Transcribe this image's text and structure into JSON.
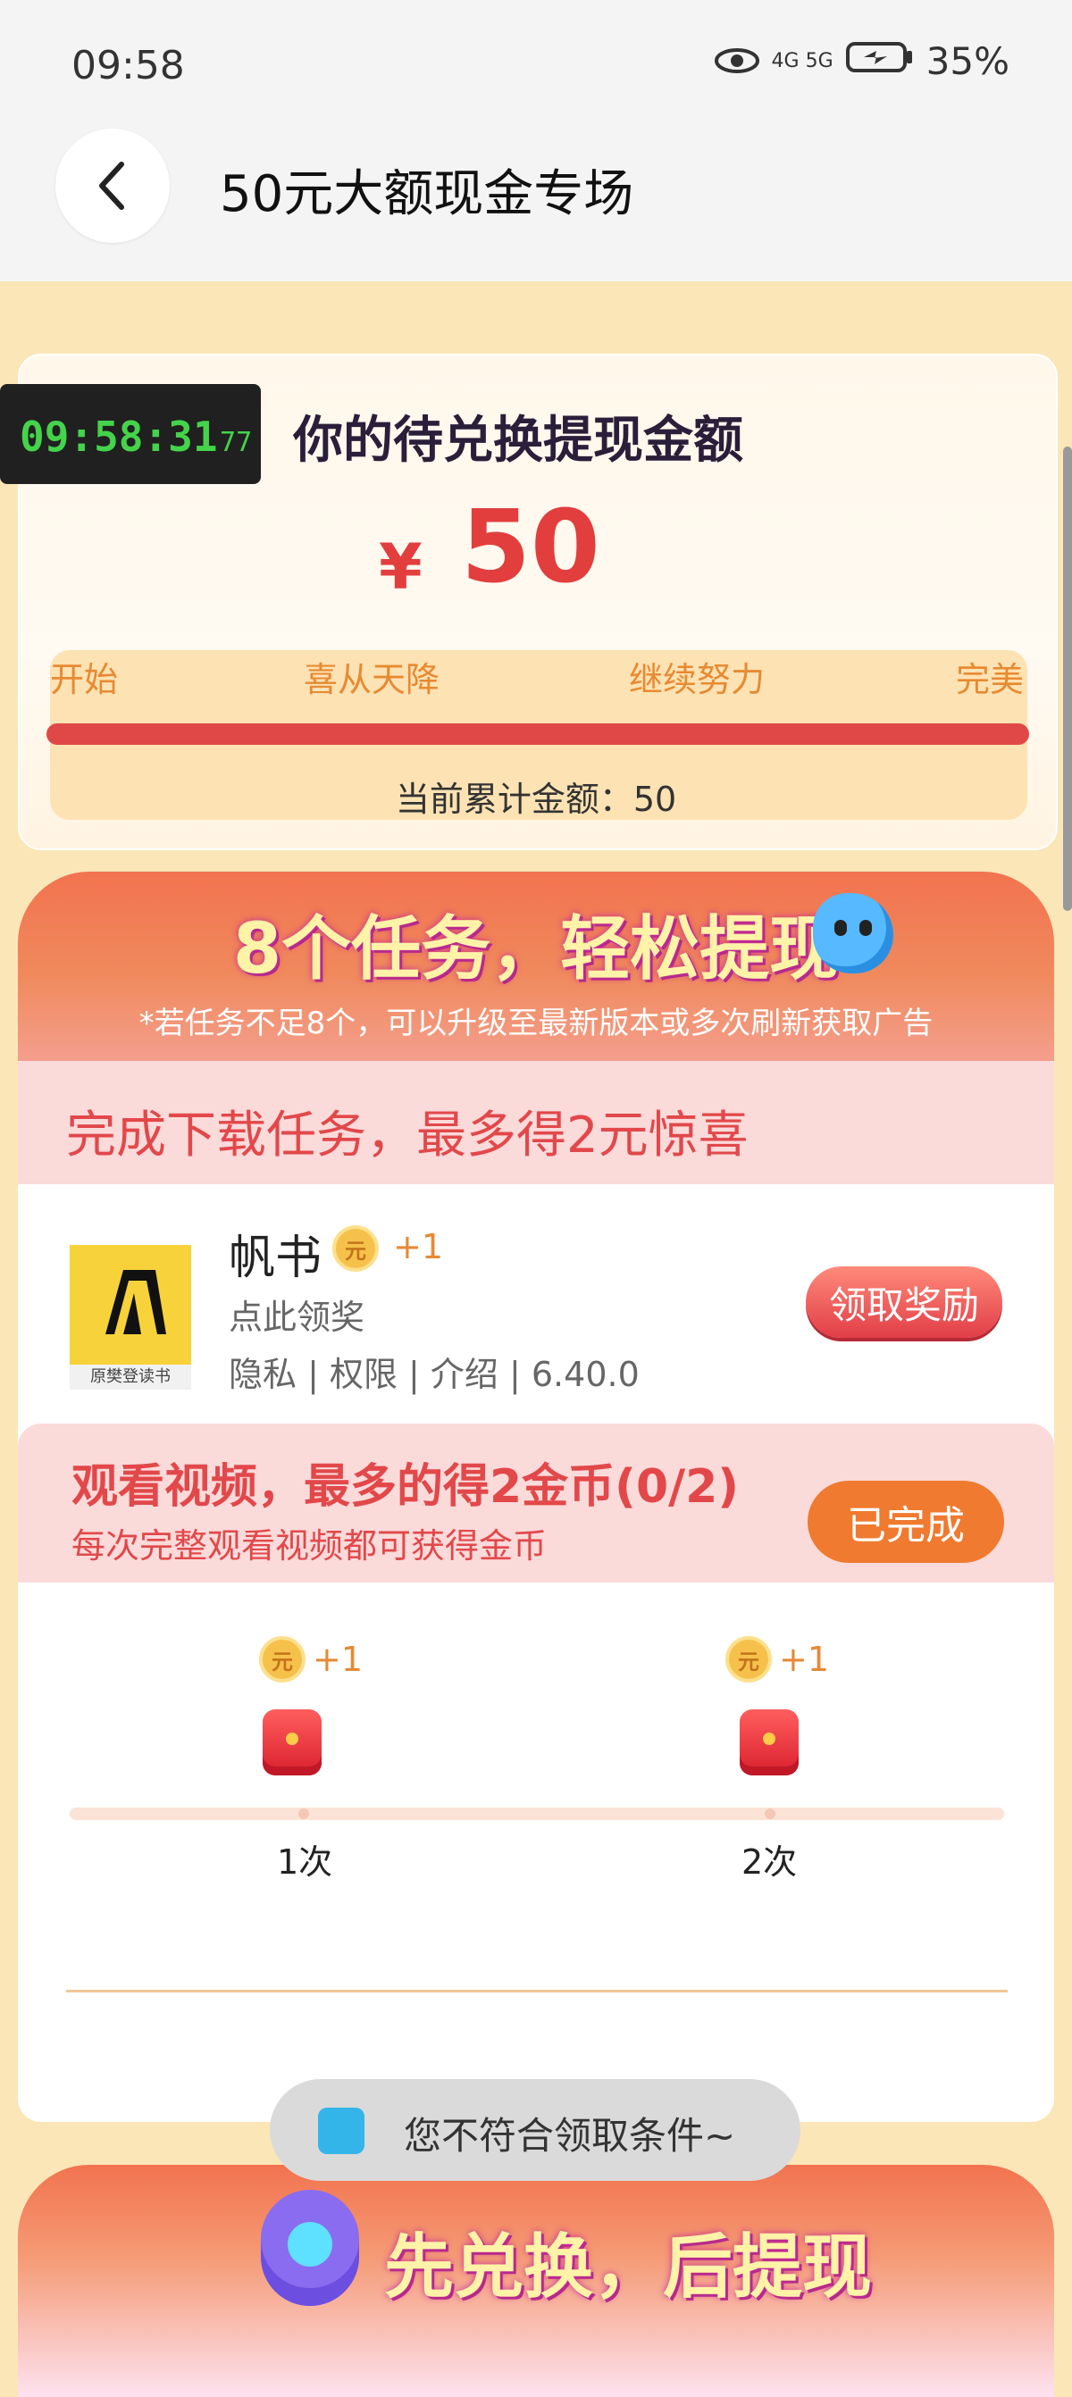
{
  "status_bar": {
    "time": "09:58",
    "network": "4G 5G",
    "battery": "35%"
  },
  "header": {
    "title": "50元大额现金专场"
  },
  "amount_card": {
    "timer_main": "09:58:31",
    "timer_ms": ".77",
    "title": "你的待兑换提现金额",
    "currency": "¥",
    "amount": "50",
    "stages": [
      "开始",
      "喜从天降",
      "继续努力",
      "完美"
    ],
    "progress": 1.0,
    "total_label": "当前累计金额：50"
  },
  "tasks": {
    "title_num": "8",
    "title_rest": "个任务，轻松提现",
    "note": "*若任务不足8个，可以升级至最新版本或多次刷新获取广告"
  },
  "download_task": {
    "title": "完成下载任务，最多得2元惊喜",
    "app_name": "帆书",
    "coin_text": "元",
    "coin_plus": "+1",
    "subtitle": "点此领奖",
    "meta": "隐私 | 权限 | 介绍 | 6.40.0",
    "app_tag": "原樊登读书",
    "button": "领取奖励"
  },
  "video_task": {
    "title": "观看视频，最多的得2金币(0/2)",
    "subtitle": "每次完整观看视频都可获得金币",
    "button": "已完成",
    "rewards": [
      {
        "coin_text": "元",
        "plus": "+1",
        "label": "1次"
      },
      {
        "coin_text": "元",
        "plus": "+1",
        "label": "2次"
      }
    ]
  },
  "toast": {
    "text": "您不符合领取条件~"
  },
  "bottom_banner": {
    "title": "先兑换，后提现"
  }
}
